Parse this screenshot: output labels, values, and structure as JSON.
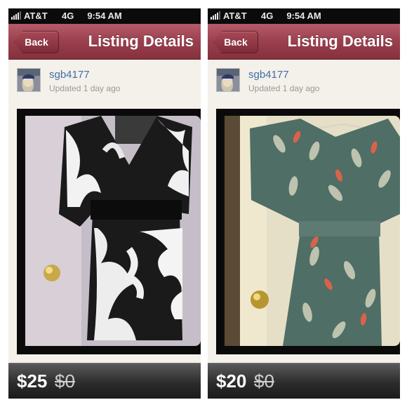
{
  "status": {
    "carrier": "AT&T",
    "network": "4G",
    "time": "9:54 AM"
  },
  "nav": {
    "back_label": "Back",
    "title": "Listing Details"
  },
  "colors": {
    "nav_accent": "#9a3f4d",
    "username": "#3f6fa6",
    "price_bar": "#2c2c2c"
  },
  "listings": [
    {
      "seller": "sgb4177",
      "updated": "Updated 1 day ago",
      "price": "$25",
      "original_price": "$0",
      "photo": "black-and-white-swirl-dress-photo"
    },
    {
      "seller": "sgb4177",
      "updated": "Updated 1 day ago",
      "price": "$20",
      "original_price": "$0",
      "photo": "teal-feather-print-dress-photo"
    }
  ]
}
